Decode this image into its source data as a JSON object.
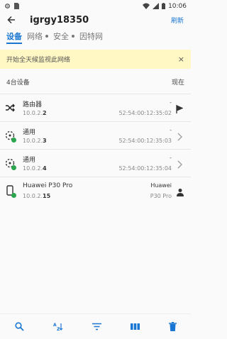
{
  "status": {
    "time": "10:06"
  },
  "app_bar": {
    "title": "igrgy18350",
    "refresh_label": "刷新"
  },
  "tabs": [
    {
      "label": "设备"
    },
    {
      "label": "网络"
    },
    {
      "label": "安全"
    },
    {
      "label": "因特网"
    }
  ],
  "banner": {
    "text": "开始全天候监视此网络",
    "close": "×"
  },
  "list_header": {
    "count": "4台设备",
    "time": "现在"
  },
  "devices": [
    {
      "name": "路由器",
      "ip_prefix": "10.0.2.",
      "ip_suffix": "2",
      "meta": "-",
      "mac": "52:54:00:12:35:02",
      "icon": "router-shuffle-icon",
      "action_icon": "flag-icon"
    },
    {
      "name": "通用",
      "ip_prefix": "10.0.2.",
      "ip_suffix": "3",
      "meta": "-",
      "mac": "52:54:00:12:35:03",
      "icon": "generic-device-icon",
      "action_icon": "chevron-right-icon"
    },
    {
      "name": "通用",
      "ip_prefix": "10.0.2.",
      "ip_suffix": "4",
      "meta": "-",
      "mac": "52:54:00:12:35:04",
      "icon": "generic-device-icon",
      "action_icon": "chevron-right-icon"
    },
    {
      "name": "Huawei P30 Pro",
      "ip_prefix": "10.0.2.",
      "ip_suffix": "15",
      "meta": "Huawei",
      "mac": "P30 Pro",
      "icon": "phone-icon",
      "action_icon": "person-icon"
    }
  ],
  "colors": {
    "accent": "#1976d2",
    "online": "#2da44e",
    "banner_bg": "#fff7c4"
  },
  "bottom_bar": [
    "search-icon",
    "sort-az-icon",
    "filter-icon",
    "columns-icon",
    "delete-icon"
  ]
}
